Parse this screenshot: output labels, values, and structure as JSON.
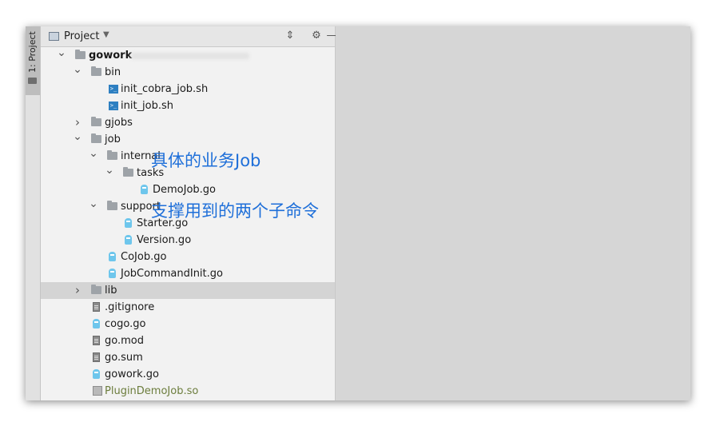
{
  "sidebar_tab": {
    "label": "1: Project"
  },
  "panel": {
    "title": "Project"
  },
  "tree": [
    {
      "label": "gowork",
      "depth": 0,
      "arrow": "down",
      "icon": "folder",
      "bold": true,
      "blurred_path": true
    },
    {
      "label": "bin",
      "depth": 1,
      "arrow": "down",
      "icon": "folder"
    },
    {
      "label": "init_cobra_job.sh",
      "depth": 2,
      "icon": "shell"
    },
    {
      "label": "init_job.sh",
      "depth": 2,
      "icon": "shell"
    },
    {
      "label": "gjobs",
      "depth": 1,
      "arrow": "right",
      "icon": "folder"
    },
    {
      "label": "job",
      "depth": 1,
      "arrow": "down",
      "icon": "folder"
    },
    {
      "label": "internal",
      "depth": 2,
      "arrow": "down",
      "icon": "folder"
    },
    {
      "label": "tasks",
      "depth": 3,
      "arrow": "down",
      "icon": "folder"
    },
    {
      "label": "DemoJob.go",
      "depth": 4,
      "icon": "go"
    },
    {
      "label": "support",
      "depth": 2,
      "arrow": "down",
      "icon": "folder"
    },
    {
      "label": "Starter.go",
      "depth": 3,
      "icon": "go"
    },
    {
      "label": "Version.go",
      "depth": 3,
      "icon": "go"
    },
    {
      "label": "CoJob.go",
      "depth": 2,
      "icon": "go"
    },
    {
      "label": "JobCommandInit.go",
      "depth": 2,
      "icon": "go"
    },
    {
      "label": "lib",
      "depth": 1,
      "arrow": "right",
      "icon": "folder",
      "selected": true
    },
    {
      "label": ".gitignore",
      "depth": 1,
      "icon": "text"
    },
    {
      "label": "cogo.go",
      "depth": 1,
      "icon": "go"
    },
    {
      "label": "go.mod",
      "depth": 1,
      "icon": "text"
    },
    {
      "label": "go.sum",
      "depth": 1,
      "icon": "text"
    },
    {
      "label": "gowork.go",
      "depth": 1,
      "icon": "go"
    },
    {
      "label": "PluginDemoJob.so",
      "depth": 1,
      "icon": "so"
    }
  ],
  "annotations": {
    "internal_note": "具体的业务Job",
    "support_note": "支撑用到的两个子命令"
  },
  "colors": {
    "annotation": "#1e6fd9",
    "selected_row": "#d4d4d4",
    "so_file": "#6c7d3d"
  },
  "icons": {
    "header": [
      "project-view-icon",
      "dropdown-arrow-icon",
      "collapse-all-icon",
      "gear-icon",
      "minimize-icon"
    ]
  }
}
